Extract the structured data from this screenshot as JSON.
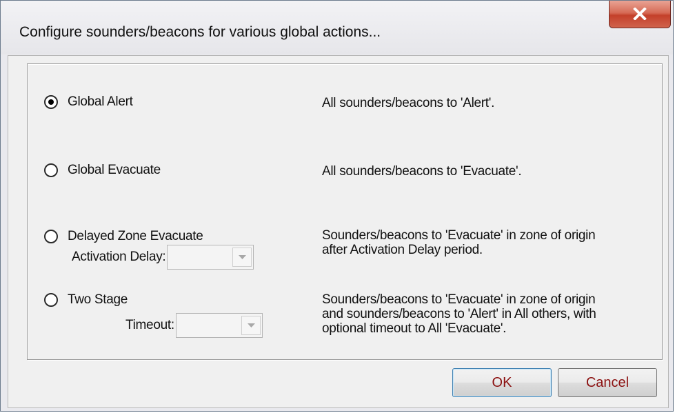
{
  "window": {
    "title": "Configure sounders/beacons for various global actions...",
    "close_icon": "close-x-icon"
  },
  "options": [
    {
      "label": "Global Alert",
      "checked": true,
      "description": [
        "All sounders/beacons to 'Alert'."
      ]
    },
    {
      "label": "Global Evacuate",
      "checked": false,
      "description": [
        "All sounders/beacons to 'Evacuate'."
      ]
    },
    {
      "label": "Delayed Zone Evacuate",
      "checked": false,
      "field_label": "Activation Delay:",
      "field_value": "",
      "description": [
        "Sounders/beacons to 'Evacuate' in zone of origin",
        "after Activation Delay period."
      ]
    },
    {
      "label": "Two Stage",
      "checked": false,
      "field_label": "Timeout:",
      "field_value": "",
      "description": [
        "Sounders/beacons to 'Evacuate' in zone of origin",
        "and sounders/beacons to 'Alert' in All others, with",
        "optional timeout to All 'Evacuate'."
      ]
    }
  ],
  "buttons": {
    "ok": "OK",
    "cancel": "Cancel"
  },
  "colors": {
    "button_text": "#8b1010",
    "close_button": "#c4402a"
  }
}
